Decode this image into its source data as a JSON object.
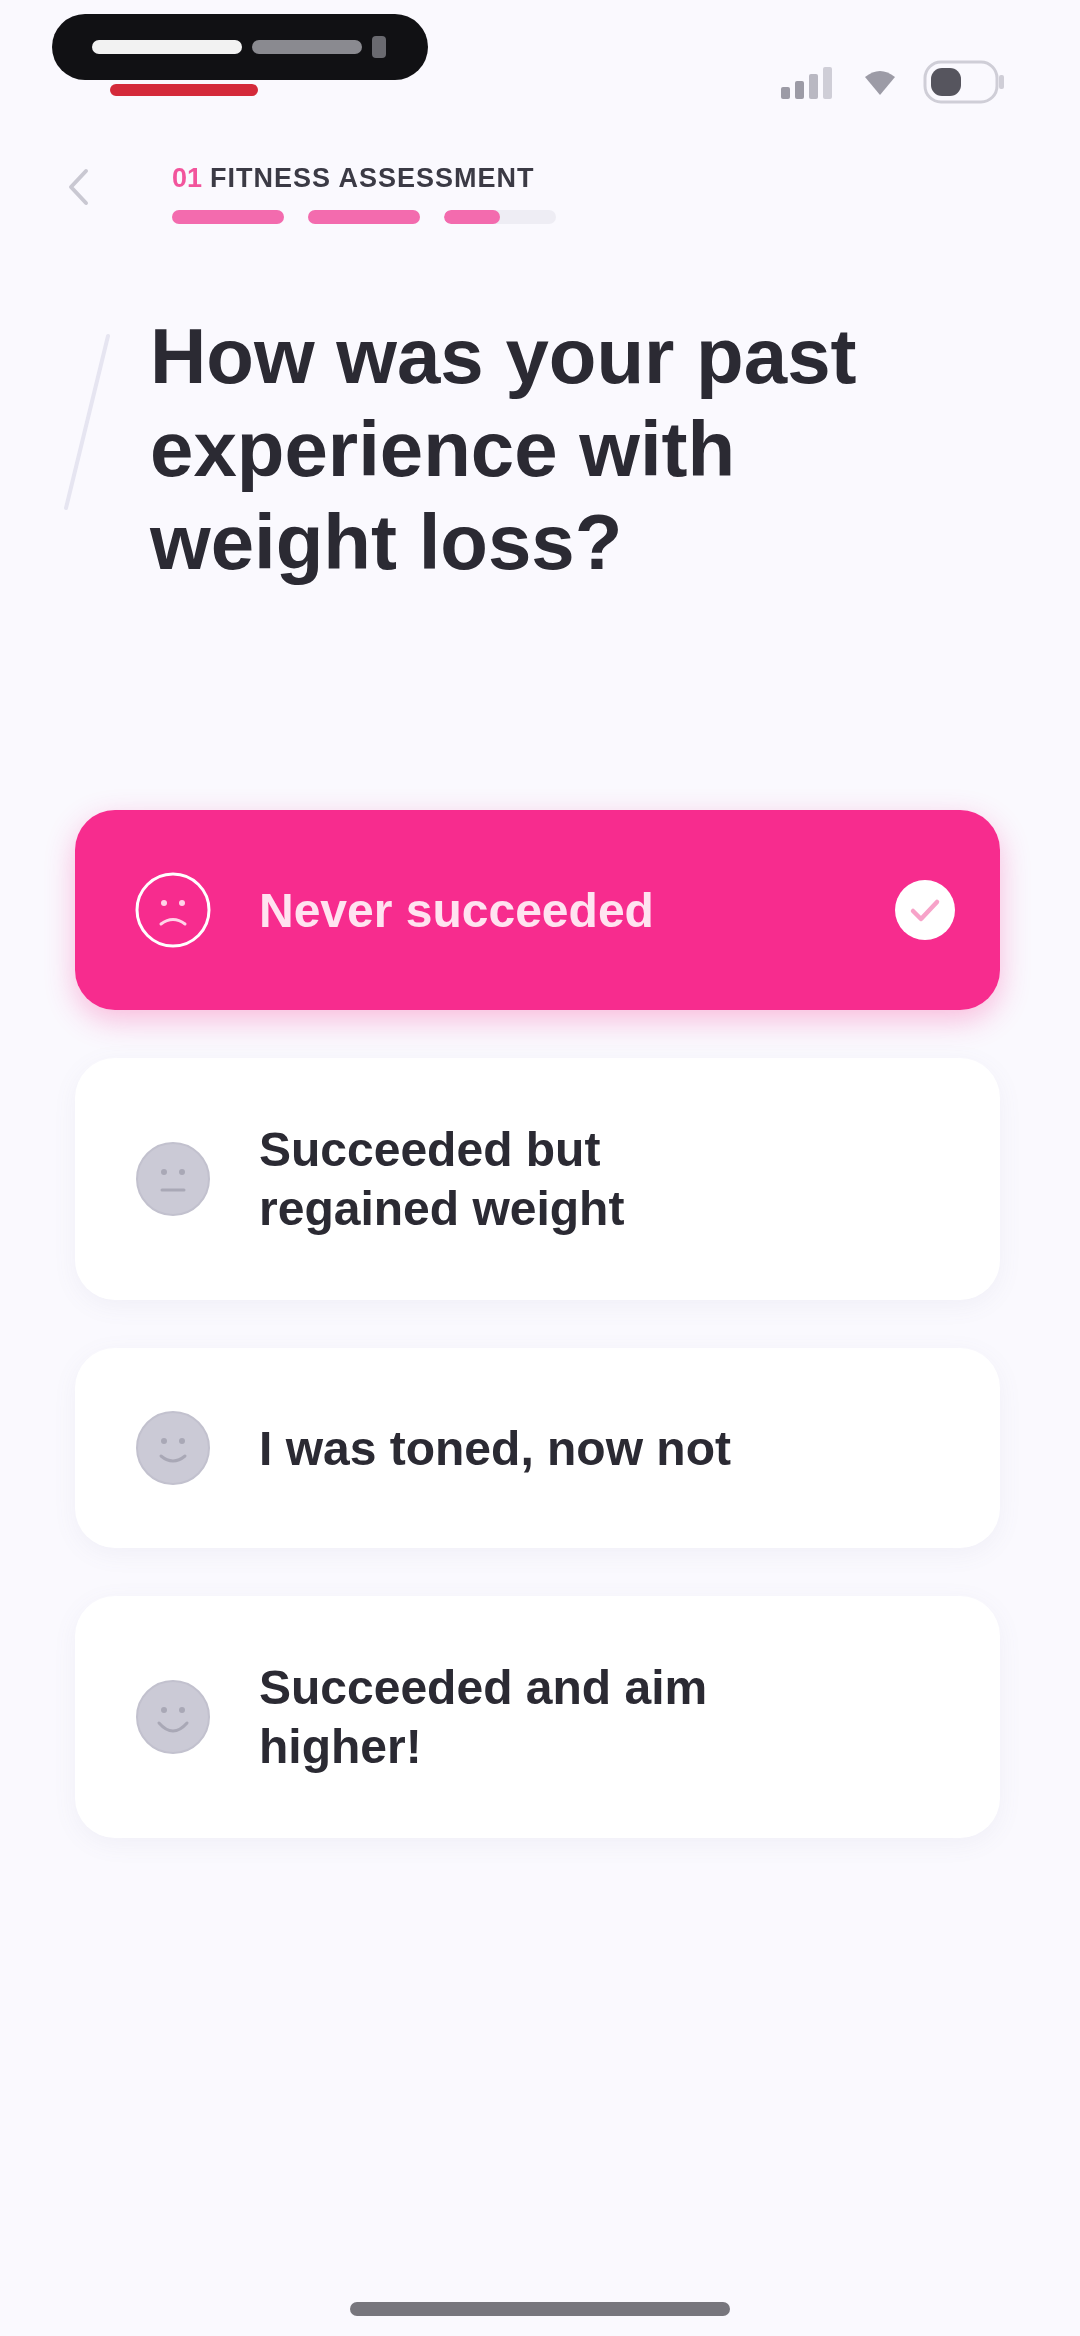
{
  "header": {
    "step": "01",
    "section": "FITNESS ASSESSMENT",
    "progress": [
      {
        "kind": "done"
      },
      {
        "kind": "done"
      },
      {
        "kind": "current",
        "level": 0.5
      }
    ]
  },
  "question": "How was your past experience with weight loss?",
  "options": [
    {
      "label": "Never succeeded",
      "selected": true
    },
    {
      "label": "Succeeded but regained weight",
      "selected": false
    },
    {
      "label": "I was toned, now not",
      "selected": false
    },
    {
      "label": "Succeeded and aim higher!",
      "selected": false
    }
  ]
}
